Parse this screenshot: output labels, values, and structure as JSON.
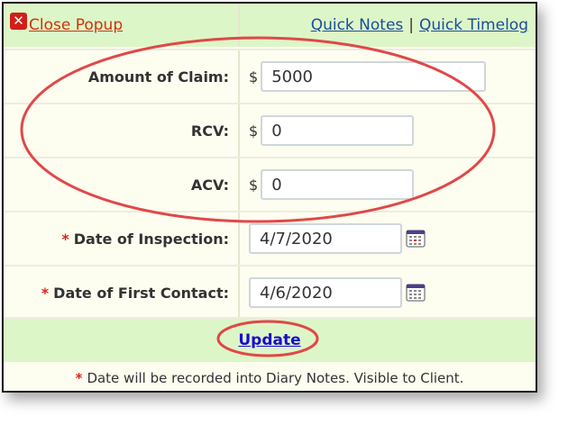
{
  "header": {
    "close_label": "Close Popup",
    "quick_notes": "Quick Notes",
    "separator": "|",
    "quick_timelog": "Quick Timelog"
  },
  "fields": {
    "amount_label": "Amount of Claim:",
    "amount_currency": "$",
    "amount_value": "5000",
    "rcv_label": "RCV:",
    "rcv_currency": "$",
    "rcv_value": "0",
    "acv_label": "ACV:",
    "acv_currency": "$",
    "acv_value": "0",
    "required_marker": "*",
    "inspection_label": "Date of Inspection:",
    "inspection_value": "4/7/2020",
    "first_contact_label": "Date of First Contact:",
    "first_contact_value": "4/6/2020"
  },
  "footer": {
    "update_label": "Update",
    "note_marker": "*",
    "note_text": "Date will be recorded into Diary Notes. Visible to Client."
  },
  "colors": {
    "header_bg": "#ddf6c8",
    "panel_bg": "#fdfdf0",
    "required": "#d6261c",
    "close_link": "#d0330a",
    "link": "#1a4d99",
    "annotation": "#e04848"
  },
  "icons": {
    "close": "close-x-icon",
    "calendar": "calendar-icon"
  }
}
